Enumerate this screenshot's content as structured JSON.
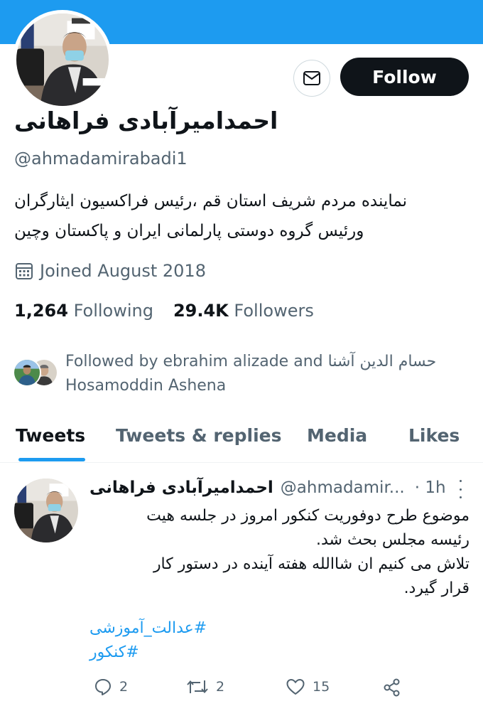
{
  "profile": {
    "display_name": "احمدامیرآبادی فراهانی",
    "handle": "@ahmadamirabadi1",
    "bio_lines": [
      "نماینده مردم شریف استان قم ،رئیس فراکسیون ایثارگران",
      "ورئیس گروه دوستی پارلمانی ایران و پاکستان وچین"
    ],
    "joined": "Joined August 2018",
    "following_count": "1,264",
    "following_label": "Following",
    "followers_count": "29.4K",
    "followers_label": "Followers",
    "followed_by_line1": "Followed by ebrahim alizade and حسام الدین آشنا",
    "followed_by_line2": "Hosamoddin Ashena"
  },
  "buttons": {
    "follow_label": "Follow",
    "message_icon": "envelope-icon"
  },
  "tabs": [
    {
      "label": "Tweets",
      "active": true
    },
    {
      "label": "Tweets & replies",
      "active": false
    },
    {
      "label": "Media",
      "active": false
    },
    {
      "label": "Likes",
      "active": false
    }
  ],
  "tweet": {
    "name": "احمدامیرآبادی فراهانی",
    "handle": "@ahmadamir...",
    "time": "· 1h",
    "lines": [
      "موضوع طرح دوفوریت کنکور امروز در جلسه هیت",
      "رئیسه مجلس بحث شد.",
      "تلاش می کنیم ان شاالله هفته آینده در دستور کار",
      "قرار گیرد."
    ],
    "hashtags": [
      "#عدالت_آموزشی",
      "#کنکور"
    ],
    "replies": "2",
    "retweets": "2",
    "likes": "15"
  },
  "colors": {
    "banner": "#1d9bf0",
    "accent": "#1d9bf0",
    "text_primary": "#0f1419",
    "text_secondary": "#536471"
  }
}
